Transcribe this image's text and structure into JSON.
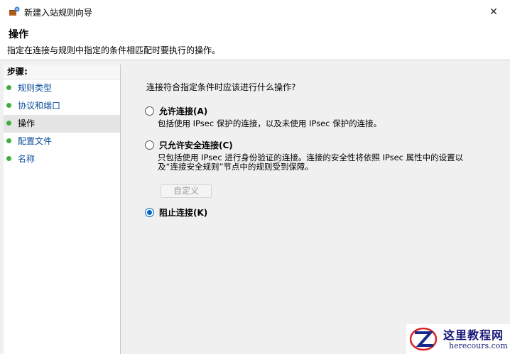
{
  "window": {
    "title": "新建入站规则向导",
    "close_glyph": "✕"
  },
  "header": {
    "title": "操作",
    "description": "指定在连接与规则中指定的条件相匹配时要执行的操作。"
  },
  "sidebar": {
    "heading": "步骤:",
    "items": [
      {
        "label": "规则类型",
        "active": false
      },
      {
        "label": "协议和端口",
        "active": false
      },
      {
        "label": "操作",
        "active": true
      },
      {
        "label": "配置文件",
        "active": false
      },
      {
        "label": "名称",
        "active": false
      }
    ]
  },
  "main": {
    "question": "连接符合指定条件时应该进行什么操作?",
    "options": [
      {
        "label": "允许连接(A)",
        "description": "包括使用 IPsec 保护的连接，以及未使用 IPsec 保护的连接。",
        "checked": false
      },
      {
        "label": "只允许安全连接(C)",
        "description": "只包括使用 IPsec 进行身份验证的连接。连接的安全性将依照 IPsec 属性中的设置以及“连接安全规则”节点中的规则受到保障。",
        "checked": false
      },
      {
        "label": "阻止连接(K)",
        "description": "",
        "checked": true
      }
    ],
    "custom_button": "自定义"
  },
  "watermark": {
    "title": "这里教程网",
    "url": "herecours.com"
  },
  "colors": {
    "accent": "#0067c0",
    "step_link": "#0b4f9e",
    "step_dot": "#3fae3f"
  }
}
